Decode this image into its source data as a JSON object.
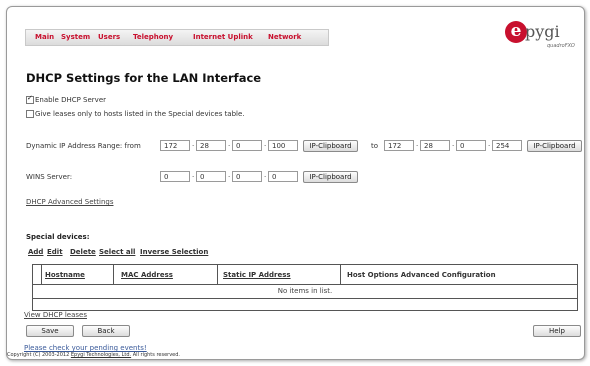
{
  "menu": {
    "items": [
      {
        "label": "Main"
      },
      {
        "label": "System"
      },
      {
        "label": "Users"
      },
      {
        "label": "Telephony"
      },
      {
        "label": "Internet Uplink"
      },
      {
        "label": "Network"
      }
    ]
  },
  "logo": {
    "letter": "e",
    "name": "pygi",
    "sub": "quadroFXO",
    "brand_color": "#c8102e"
  },
  "page_title": "DHCP Settings for the LAN Interface",
  "options": {
    "enable_dhcp": {
      "label": "Enable DHCP Server",
      "checked": true
    },
    "give_leases": {
      "label": "Give leases only to hosts listed in the Special devices table.",
      "checked": false
    }
  },
  "range": {
    "label": "Dynamic IP Address Range: from",
    "from": [
      "172",
      "28",
      "0",
      "100"
    ],
    "to_label": "to",
    "to": [
      "172",
      "28",
      "0",
      "254"
    ],
    "clipboard_label": "IP-Clipboard",
    "dot": "."
  },
  "wins": {
    "label": "WINS Server:",
    "values": [
      "0",
      "0",
      "0",
      "0"
    ],
    "clipboard_label": "IP-Clipboard"
  },
  "advanced_link": "DHCP Advanced Settings",
  "special": {
    "title": "Special devices:",
    "actions": [
      "Add",
      "Edit",
      "Delete",
      "Select all",
      "Inverse Selection"
    ],
    "columns": [
      "Hostname",
      "MAC Address",
      "Static IP Address",
      "Host Options Advanced Configuration"
    ],
    "empty_text": "No items in list."
  },
  "view_leases_link": "View DHCP leases",
  "buttons": {
    "save": "Save",
    "back": "Back",
    "help": "Help"
  },
  "pending_link": "Please check your pending events!",
  "copyright": {
    "prefix": "Copyright (C) 2003-2012",
    "company": "Epygi Technologies, Ltd.",
    "suffix": "All rights reserved."
  }
}
